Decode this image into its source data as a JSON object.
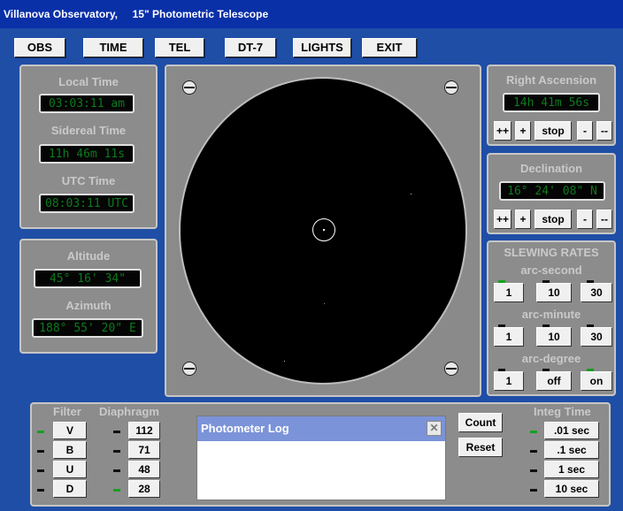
{
  "window": {
    "title": "Villanova Observatory,     15\" Photometric Telescope"
  },
  "menu": [
    "OBS",
    "TIME",
    "TEL",
    "DT-7",
    "LIGHTS",
    "EXIT"
  ],
  "time_panel": {
    "local_label": "Local Time",
    "local_value": "03:03:11 am",
    "sidereal_label": "Sidereal Time",
    "sidereal_value": "11h 46m 11s",
    "utc_label": "UTC Time",
    "utc_value": "08:03:11 UTC"
  },
  "altaz_panel": {
    "altitude_label": "Altitude",
    "altitude_value": "45° 16' 34\"",
    "azimuth_label": "Azimuth",
    "azimuth_value": "188° 55' 20\" E"
  },
  "ra_panel": {
    "label": "Right Ascension",
    "value": "14h 41m 56s",
    "buttons": [
      "++",
      "+",
      "stop",
      "-",
      "--"
    ]
  },
  "dec_panel": {
    "label": "Declination",
    "value": "16° 24' 08\" N",
    "buttons": [
      "++",
      "+",
      "stop",
      "-",
      "--"
    ]
  },
  "slew_panel": {
    "title": "SLEWING RATES",
    "groups": [
      {
        "label": "arc-second",
        "buttons": [
          "1",
          "10",
          "30"
        ]
      },
      {
        "label": "arc-minute",
        "buttons": [
          "1",
          "10",
          "30"
        ]
      },
      {
        "label": "arc-degree",
        "buttons": [
          "1",
          "off",
          "on"
        ]
      }
    ]
  },
  "bottom_panel": {
    "filter_label": "Filter",
    "diaphragm_label": "Diaphragm",
    "filters": [
      "V",
      "B",
      "U",
      "D"
    ],
    "diaphragms": [
      "112",
      "71",
      "48",
      "28"
    ],
    "count_label": "Count",
    "reset_label": "Reset",
    "integ_label": "Integ Time",
    "integ_times": [
      ".01 sec",
      ".1 sec",
      "1 sec",
      "10 sec"
    ]
  },
  "photometer_log": {
    "title": "Photometer Log",
    "close_glyph": "✕"
  },
  "colors": {
    "background": "#1f4ea6",
    "panel": "#8c8c8c",
    "lcd_text": "#0d7a1f",
    "led_on": "#15a020"
  }
}
